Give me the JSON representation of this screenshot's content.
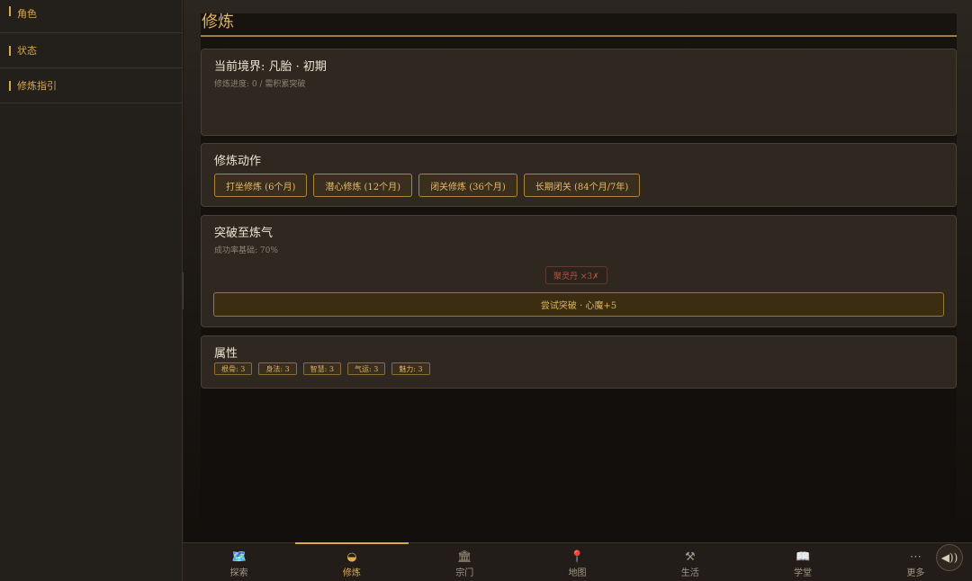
{
  "sidebar": {
    "items": [
      {
        "label": "角色"
      },
      {
        "label": "状态"
      },
      {
        "label": "修炼指引"
      }
    ]
  },
  "page": {
    "title": "修炼"
  },
  "realm": {
    "title": "当前境界: 凡胎 · 初期",
    "progress": "修炼进度: 0 / 需积累突破"
  },
  "actions": {
    "title": "修炼动作",
    "buttons": [
      {
        "label": "打坐修炼 (6个月)"
      },
      {
        "label": "潜心修炼 (12个月)"
      },
      {
        "label": "闭关修炼 (36个月)"
      },
      {
        "label": "长期闭关 (84个月/7年)"
      }
    ]
  },
  "breakthrough": {
    "title": "突破至炼气",
    "success_rate": "成功率基础: 70%",
    "missing_item": "聚灵丹 ×3✗",
    "button_label": "尝试突破 · 心魔+5"
  },
  "attributes": {
    "title": "属性",
    "items": [
      {
        "label": "根骨: 3"
      },
      {
        "label": "身法: 3"
      },
      {
        "label": "智慧: 3"
      },
      {
        "label": "气运: 3"
      },
      {
        "label": "魅力: 3"
      }
    ]
  },
  "bottom_nav": {
    "items": [
      {
        "label": "探索",
        "icon": "🗺️"
      },
      {
        "label": "修炼",
        "icon": "◒"
      },
      {
        "label": "宗门",
        "icon": "🏛"
      },
      {
        "label": "地图",
        "icon": "📍"
      },
      {
        "label": "生活",
        "icon": "⚒"
      },
      {
        "label": "学堂",
        "icon": "📖"
      },
      {
        "label": "更多",
        "icon": "⋯"
      }
    ],
    "active": "修炼"
  },
  "colors": {
    "accent": "#d9a84a",
    "warning": "#b6573f"
  }
}
